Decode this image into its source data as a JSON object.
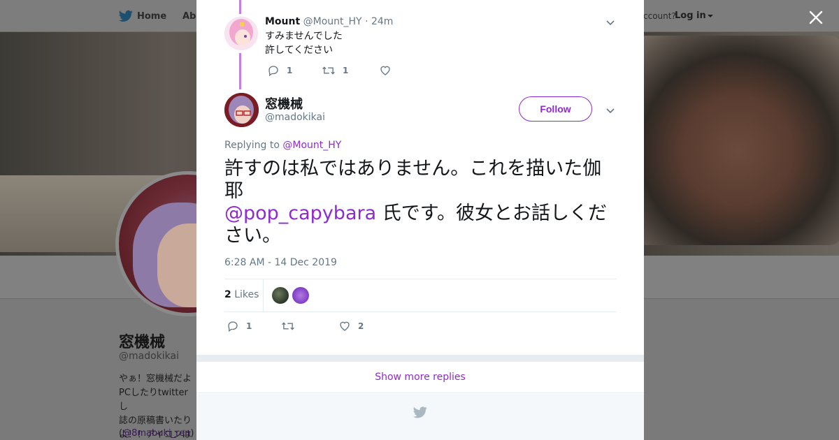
{
  "nav": {
    "home_label": "Home",
    "about_label": "Abo",
    "account_prompt": "ccount?",
    "login_label": "Log in"
  },
  "profile": {
    "name": "窓機械",
    "handle": "@madokikai",
    "bio": "やぁ！窓機械だよ\nPCしたりtwitterし\n誌の原稿書いたり\nよ！！アイコンは",
    "bio_link": "@8mabuki_ren",
    "bio_link_prefix": "(",
    "bio_link_suffix": ")"
  },
  "reply": {
    "author_name": "Mount",
    "author_handle": "@Mount_HY",
    "time": "· 24m",
    "text": "すみませんでした\n許してください",
    "reply_count": "1",
    "retweet_count": "1"
  },
  "tweet": {
    "author_name": "窓機械",
    "author_handle": "@madokikai",
    "follow_label": "Follow",
    "replying_prefix": "Replying to",
    "replying_to": "@Mount_HY",
    "text_part1": "許すのは私ではありません。これを描いた伽耶",
    "mention": "@pop_capybara",
    "text_part2": " 氏です。彼女とお話しください。",
    "timestamp": "6:28 AM - 14 Dec 2019",
    "likes_count": "2",
    "likes_label": "Likes",
    "reply_count": "1",
    "retweet_count": "",
    "like_count": "2"
  },
  "show_more_label": "Show more replies",
  "colors": {
    "accent": "#8e2ad0",
    "thread_line": "#c57ee6",
    "secondary_text": "#657786"
  }
}
